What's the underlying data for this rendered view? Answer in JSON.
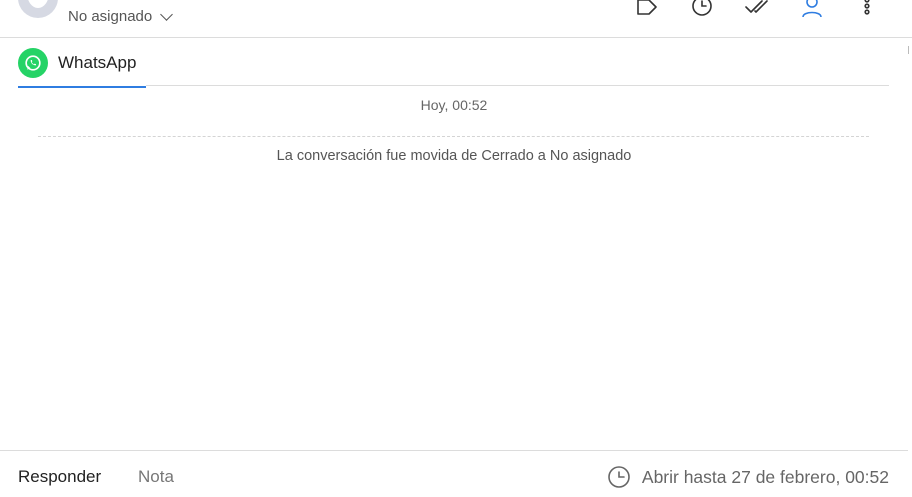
{
  "header": {
    "assignee_label": "No asignado"
  },
  "channel": {
    "name": "WhatsApp",
    "accent": "#25d366",
    "tab_underline": "#2f7de1"
  },
  "conversation": {
    "day_stamp": "Hoy, 00:52",
    "system_message": "La conversación fue movida de Cerrado a No asignado"
  },
  "composer": {
    "reply_label": "Responder",
    "note_label": "Nota",
    "snooze_text": "Abrir hasta 27 de febrero, 00:52"
  },
  "icons": [
    "tag-icon",
    "clock-icon",
    "double-check-icon",
    "user-icon",
    "more-vertical-icon",
    "whatsapp-icon"
  ]
}
